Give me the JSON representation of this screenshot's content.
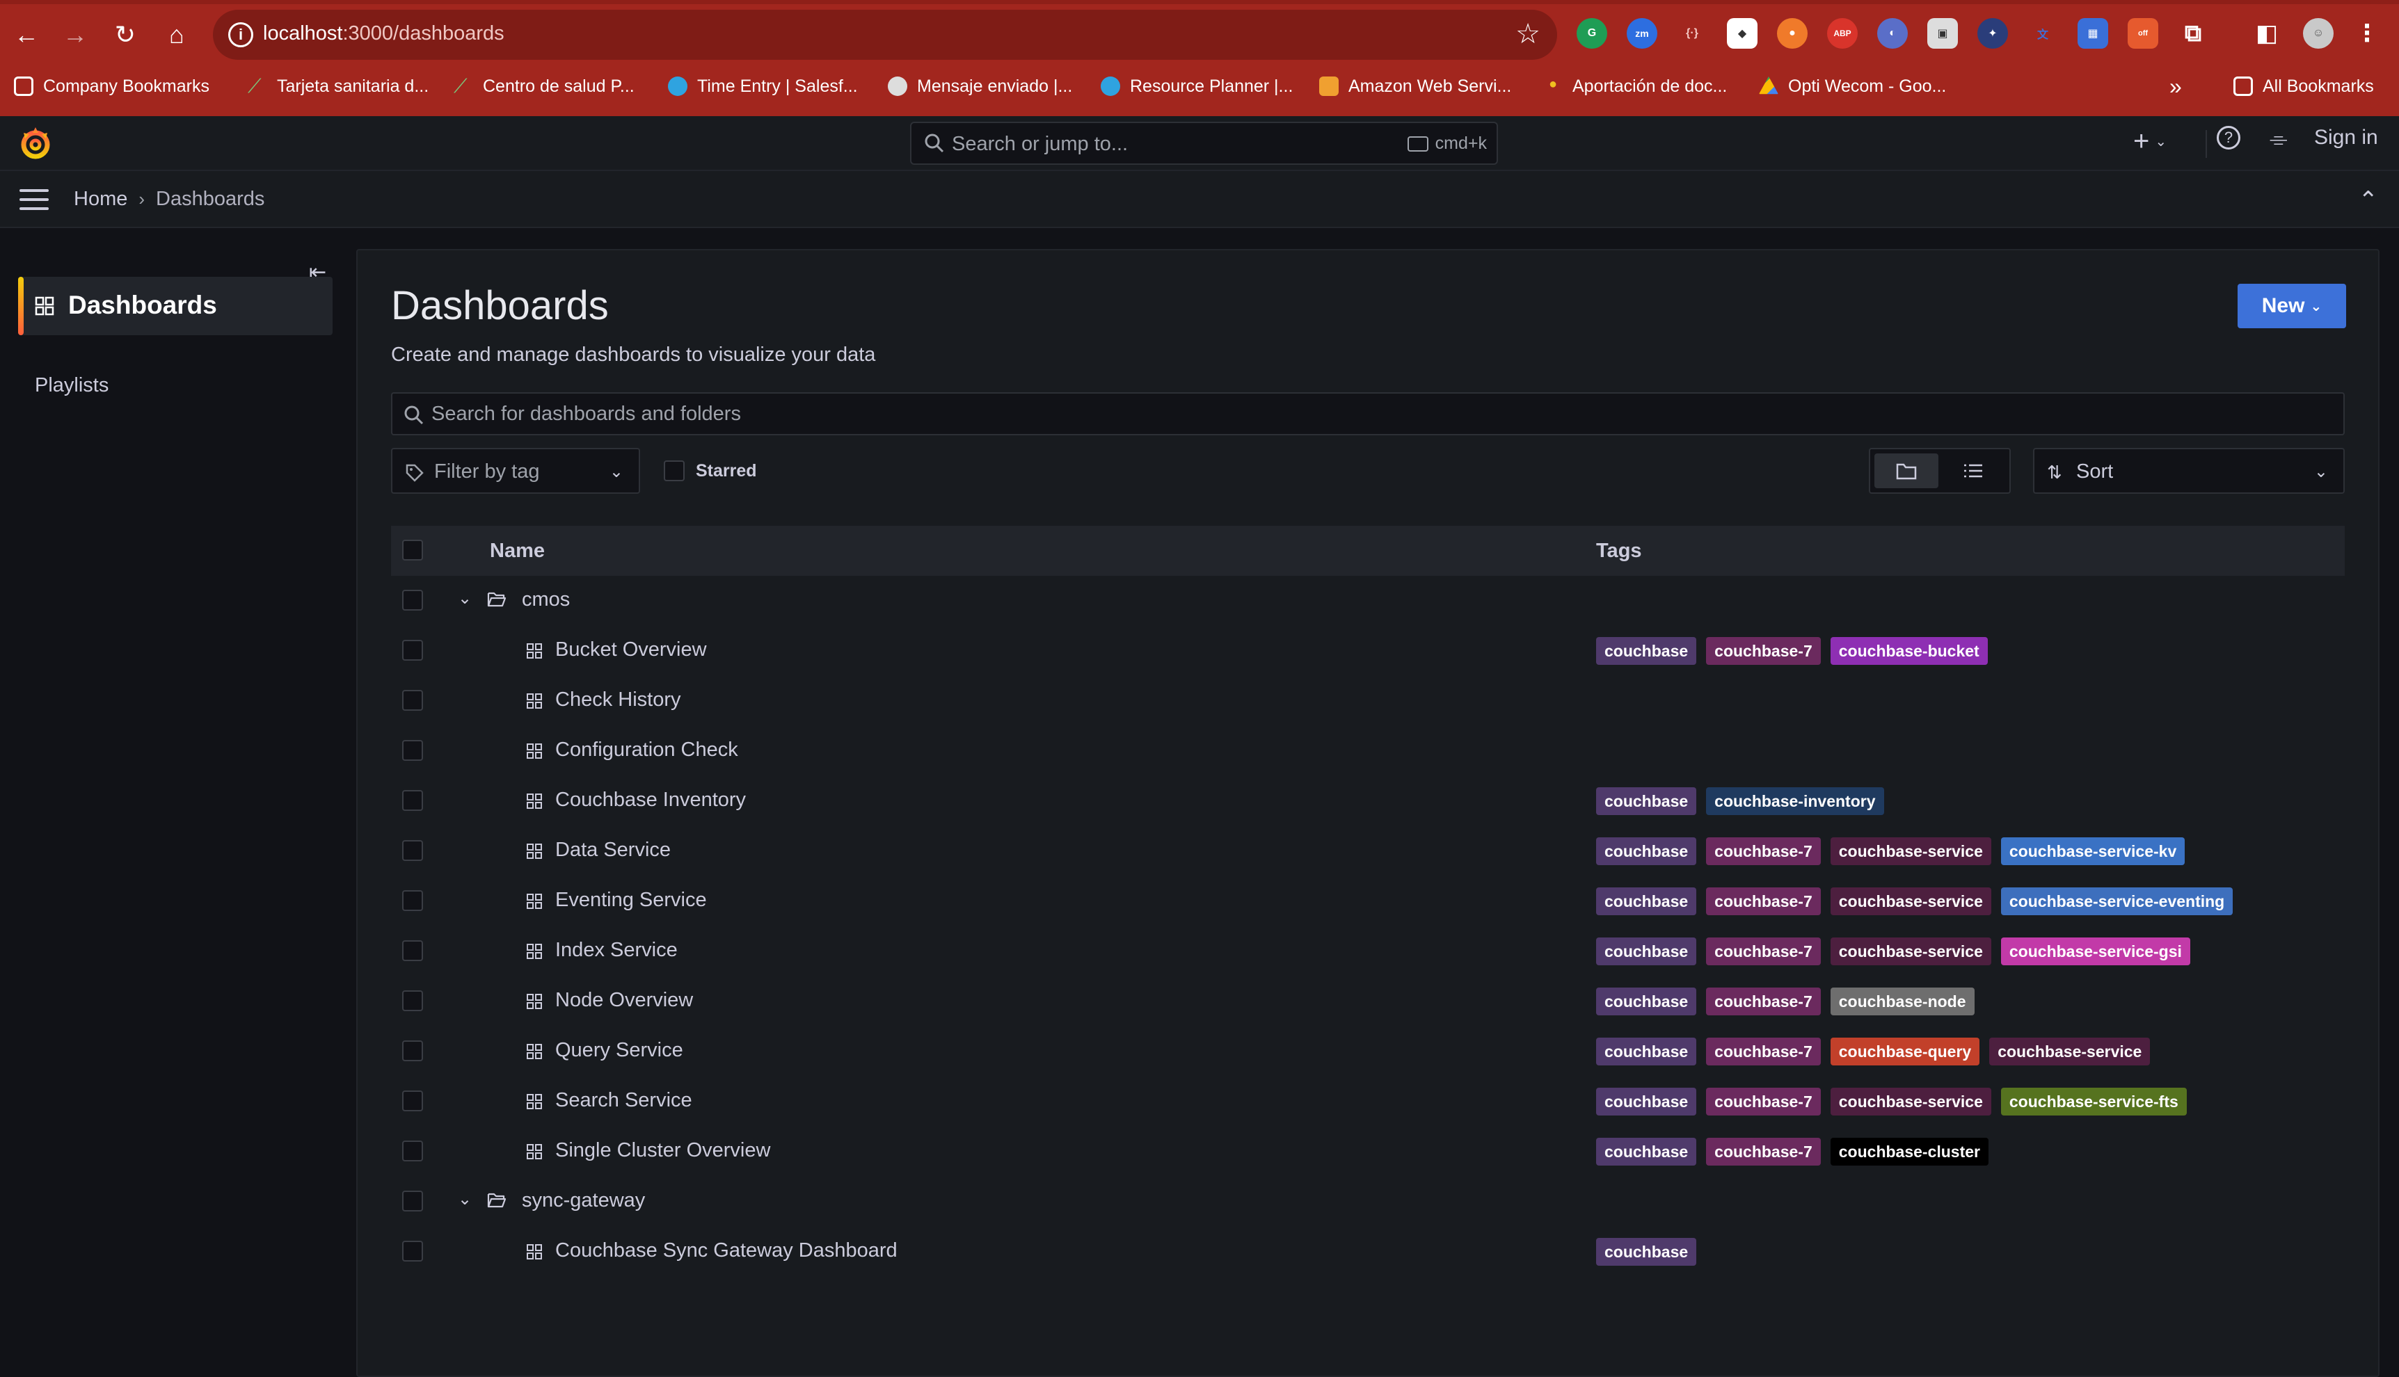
{
  "browser": {
    "url_host": "localhost",
    "url_path": ":3000/dashboards",
    "bookmarks": [
      "Company Bookmarks",
      "Tarjeta sanitaria d...",
      "Centro de salud P...",
      "Time Entry | Salesf...",
      "Mensaje enviado |...",
      "Resource Planner |...",
      "Amazon Web Servi...",
      "Aportación de doc...",
      "Opti Wecom - Goo..."
    ],
    "overflow": "»",
    "all_bookmarks": "All Bookmarks",
    "extensions": [
      "zm",
      "ABP",
      "off"
    ]
  },
  "topbar": {
    "search_placeholder": "Search or jump to...",
    "shortcut": "cmd+k",
    "plus": "+",
    "sign_in": "Sign in"
  },
  "breadcrumb": {
    "home": "Home",
    "separator": "›",
    "current": "Dashboards"
  },
  "sidebar": {
    "active_label": "Dashboards",
    "items": [
      "Playlists"
    ]
  },
  "main": {
    "title": "Dashboards",
    "subtitle": "Create and manage dashboards to visualize your data",
    "new_label": "New",
    "search_placeholder": "Search for dashboards and folders",
    "filter_tag_placeholder": "Filter by tag",
    "starred_label": "Starred",
    "sort_label": "Sort",
    "col_name": "Name",
    "col_tags": "Tags"
  },
  "tag_colors": {
    "couchbase": "#4f3a6b",
    "couchbase-7": "#6b2a5e",
    "couchbase-bucket": "#8e2fb3",
    "couchbase-inventory": "#1f3a5f",
    "couchbase-service": "#4d1f3f",
    "couchbase-service-kv": "#3a72c4",
    "couchbase-service-eventing": "#3d6fbd",
    "couchbase-service-gsi": "#c23aa8",
    "couchbase-node": "#6e6e6e",
    "couchbase-query": "#c2402a",
    "couchbase-service-fts": "#56731f",
    "couchbase-cluster": "#000000"
  },
  "rows": [
    {
      "type": "folder",
      "name": "cmos",
      "tags": []
    },
    {
      "type": "dashboard",
      "name": "Bucket Overview",
      "tags": [
        "couchbase",
        "couchbase-7",
        "couchbase-bucket"
      ]
    },
    {
      "type": "dashboard",
      "name": "Check History",
      "tags": []
    },
    {
      "type": "dashboard",
      "name": "Configuration Check",
      "tags": []
    },
    {
      "type": "dashboard",
      "name": "Couchbase Inventory",
      "tags": [
        "couchbase",
        "couchbase-inventory"
      ]
    },
    {
      "type": "dashboard",
      "name": "Data Service",
      "tags": [
        "couchbase",
        "couchbase-7",
        "couchbase-service",
        "couchbase-service-kv"
      ]
    },
    {
      "type": "dashboard",
      "name": "Eventing Service",
      "tags": [
        "couchbase",
        "couchbase-7",
        "couchbase-service",
        "couchbase-service-eventing"
      ]
    },
    {
      "type": "dashboard",
      "name": "Index Service",
      "tags": [
        "couchbase",
        "couchbase-7",
        "couchbase-service",
        "couchbase-service-gsi"
      ]
    },
    {
      "type": "dashboard",
      "name": "Node Overview",
      "tags": [
        "couchbase",
        "couchbase-7",
        "couchbase-node"
      ]
    },
    {
      "type": "dashboard",
      "name": "Query Service",
      "tags": [
        "couchbase",
        "couchbase-7",
        "couchbase-query",
        "couchbase-service"
      ]
    },
    {
      "type": "dashboard",
      "name": "Search Service",
      "tags": [
        "couchbase",
        "couchbase-7",
        "couchbase-service",
        "couchbase-service-fts"
      ]
    },
    {
      "type": "dashboard",
      "name": "Single Cluster Overview",
      "tags": [
        "couchbase",
        "couchbase-7",
        "couchbase-cluster"
      ]
    },
    {
      "type": "folder",
      "name": "sync-gateway",
      "tags": []
    },
    {
      "type": "dashboard",
      "name": "Couchbase Sync Gateway Dashboard",
      "tags": [
        "couchbase"
      ]
    }
  ]
}
